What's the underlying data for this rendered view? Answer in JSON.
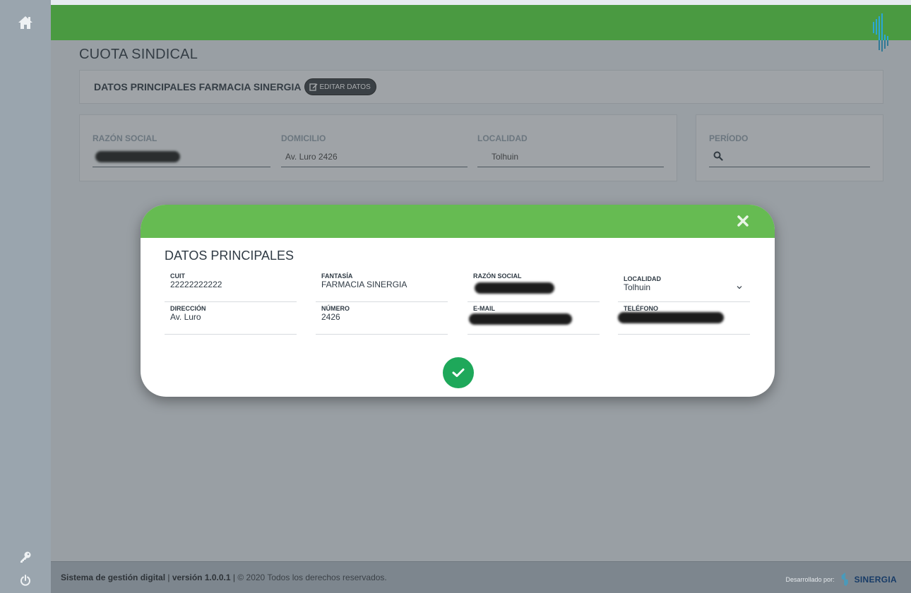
{
  "page": {
    "title": "CUOTA SINDICAL",
    "section_title": "DATOS PRINCIPALES FARMACIA SINERGIA",
    "edit_label": "EDITAR DATOS"
  },
  "fields": {
    "razon_social_label": "RAZÓN SOCIAL",
    "domicilio_label": "DOMICILIO",
    "domicilio_value": "Av. Luro 2426",
    "localidad_label": "LOCALIDAD",
    "localidad_value": "Tolhuin",
    "periodo_label": "PERÍODO"
  },
  "modal": {
    "title": "DATOS PRINCIPALES",
    "fields": [
      {
        "label": "CUIT",
        "value": "22222222222"
      },
      {
        "label": "FANTASÍA",
        "value": "FARMACIA SINERGIA"
      },
      {
        "label": "RAZÓN SOCIAL",
        "value": ""
      },
      {
        "label": "LOCALIDAD",
        "value": "Tolhuin"
      },
      {
        "label": "DIRECCIÓN",
        "value": "Av. Luro"
      },
      {
        "label": "NÚMERO",
        "value": "2426"
      },
      {
        "label": "E-MAIL",
        "value": ""
      },
      {
        "label": "TELÉFONO",
        "value": ""
      }
    ]
  },
  "footer": {
    "system": "Sistema de gestión digital",
    "version": "versión 1.0.0.1",
    "rights": "© 2020 Todos los derechos reservados.",
    "dev_by": "Desarrollado por:",
    "brand": "SINERGIA"
  },
  "colors": {
    "topbar": "#4a9a41",
    "modal_header": "#66bb52",
    "confirm": "#1ea85a",
    "sidebar": "#9aa5ae"
  },
  "icons": {
    "home": "home-icon",
    "key": "key-icon",
    "power": "power-icon",
    "search": "search-icon",
    "close": "close-icon",
    "check": "check-icon",
    "edit": "edit-icon",
    "logo": "sinergia-logo-icon"
  }
}
